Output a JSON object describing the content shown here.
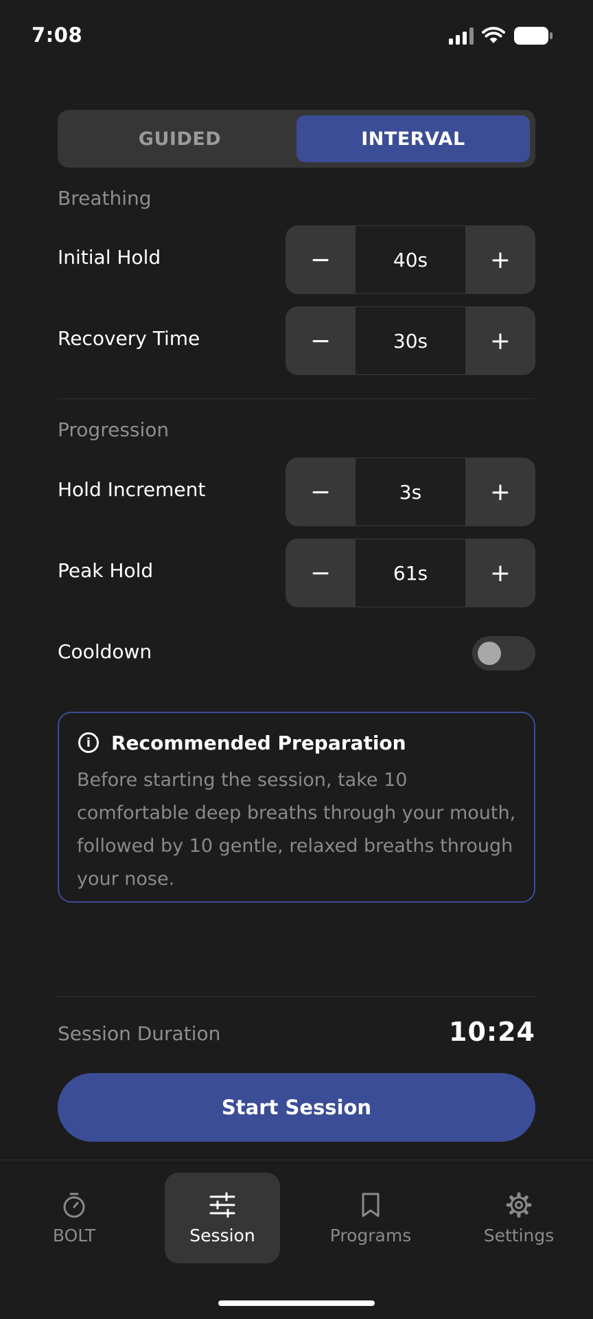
{
  "status_bar": {
    "time": "7:08"
  },
  "mode_toggle": {
    "options": [
      "GUIDED",
      "INTERVAL"
    ],
    "selected": "INTERVAL"
  },
  "breathing": {
    "title": "Breathing",
    "initial_hold": {
      "label": "Initial Hold",
      "value": "40s"
    },
    "recovery_time": {
      "label": "Recovery Time",
      "value": "30s"
    }
  },
  "progression": {
    "title": "Progression",
    "hold_increment": {
      "label": "Hold Increment",
      "value": "3s"
    },
    "peak_hold": {
      "label": "Peak Hold",
      "value": "61s"
    },
    "cooldown": {
      "label": "Cooldown",
      "enabled": false
    }
  },
  "stepper_symbols": {
    "minus": "−",
    "plus": "+"
  },
  "info": {
    "icon": "info-icon",
    "title": "Recommended Preparation",
    "body": "Before starting the session, take 10 comfortable deep breaths through your mouth, followed by 10 gentle, relaxed breaths through your nose."
  },
  "session": {
    "duration_label": "Session Duration",
    "duration_value": "10:24",
    "start_label": "Start Session"
  },
  "tabs": [
    {
      "label": "BOLT",
      "icon": "stopwatch-icon",
      "active": false
    },
    {
      "label": "Session",
      "icon": "sliders-icon",
      "active": true
    },
    {
      "label": "Programs",
      "icon": "bookmark-icon",
      "active": false
    },
    {
      "label": "Settings",
      "icon": "gear-icon",
      "active": false
    }
  ],
  "colors": {
    "accent": "#3b4d96",
    "background": "#1c1c1c",
    "surface": "#383838"
  }
}
